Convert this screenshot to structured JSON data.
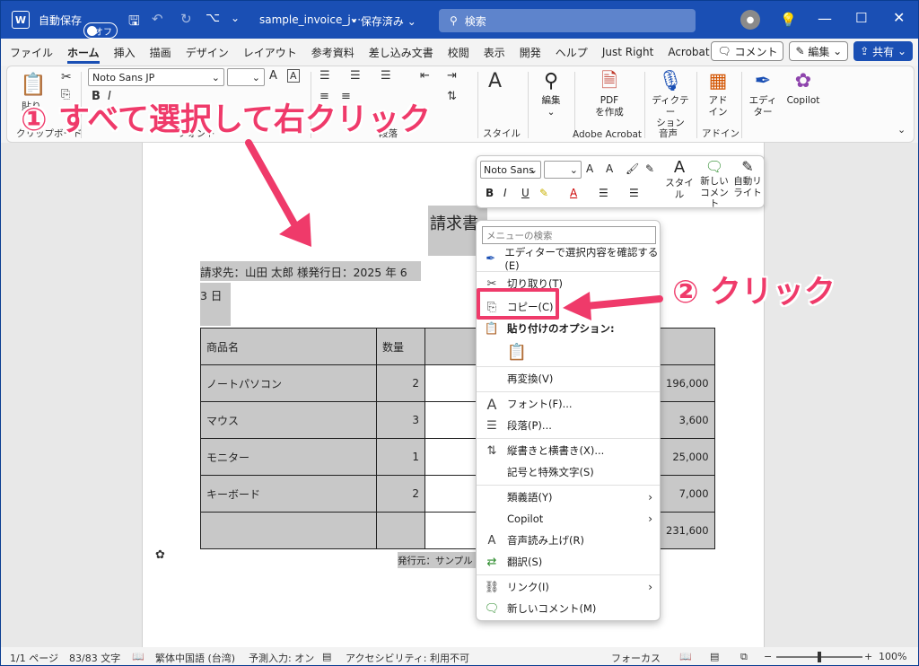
{
  "titlebar": {
    "autosave_label": "自動保存",
    "autosave_state": "オフ",
    "filename": "sample_invoice_j···",
    "saved_status": "• 保存済み",
    "search_placeholder": "検索"
  },
  "tabs": [
    "ファイル",
    "ホーム",
    "挿入",
    "描画",
    "デザイン",
    "レイアウト",
    "参考資料",
    "差し込み文書",
    "校閲",
    "表示",
    "開発",
    "ヘルプ",
    "Just Right",
    "Acrobat"
  ],
  "tab_buttons": {
    "comment": "コメント",
    "edit": "編集",
    "share": "共有"
  },
  "ribbon": {
    "font_name": "Noto Sans JP",
    "paste_label": "貼り",
    "clipboard_label": "クリップボード",
    "font_label": "フォント",
    "paragraph_label": "段落",
    "style_label": "スタイル",
    "edit_label": "編集",
    "pdf_label": "PDF\nを作成",
    "adobe_label": "Adobe Acrobat",
    "dictation_label": "ディクテー\nション",
    "voice_label": "音声",
    "addin_label": "アド\nイン",
    "addin_group": "アドイン",
    "editor_label": "エディ\nター",
    "copilot_label": "Copilot"
  },
  "document": {
    "title": "請求書",
    "line1": "請求先：山田 太郎 様発行日：2025 年 6 月",
    "line2": "3 日",
    "table_header": [
      "商品名",
      "数量"
    ],
    "rows": [
      {
        "name": "ノートパソコン",
        "qty": "2",
        "amount": "196,000"
      },
      {
        "name": "マウス",
        "qty": "3",
        "amount": "3,600"
      },
      {
        "name": "モニター",
        "qty": "1",
        "amount": "25,000"
      },
      {
        "name": "キーボード",
        "qty": "2",
        "amount": "7,000"
      }
    ],
    "total": "231,600",
    "footer": "発行元：サンプル"
  },
  "minibar": {
    "font": "Noto Sans",
    "style_label": "スタイル",
    "new_comment": "新しい\nコメント",
    "auto_light": "自動リ\nライト"
  },
  "context_menu": {
    "search_placeholder": "メニューの検索",
    "items": [
      "エディターで選択内容を確認する(E)",
      "切り取り(T)",
      "コピー(C)",
      "貼り付けのオプション:",
      "再変換(V)",
      "フォント(F)...",
      "段落(P)...",
      "縦書きと横書き(X)...",
      "記号と特殊文字(S)",
      "類義語(Y)",
      "Copilot",
      "音声読み上げ(R)",
      "翻訳(S)",
      "リンク(I)",
      "新しいコメント(M)"
    ]
  },
  "annotations": {
    "step1": "① すべて選択して右クリック",
    "step2": "② クリック",
    "accent_color": "#ef3a6a"
  },
  "statusbar": {
    "page": "1/1 ページ",
    "words": "83/83 文字",
    "language": "繁体中国語 (台湾)",
    "predict": "予測入力: オン",
    "accessibility": "アクセシビリティ: 利用不可",
    "focus": "フォーカス",
    "zoom": "100%"
  }
}
